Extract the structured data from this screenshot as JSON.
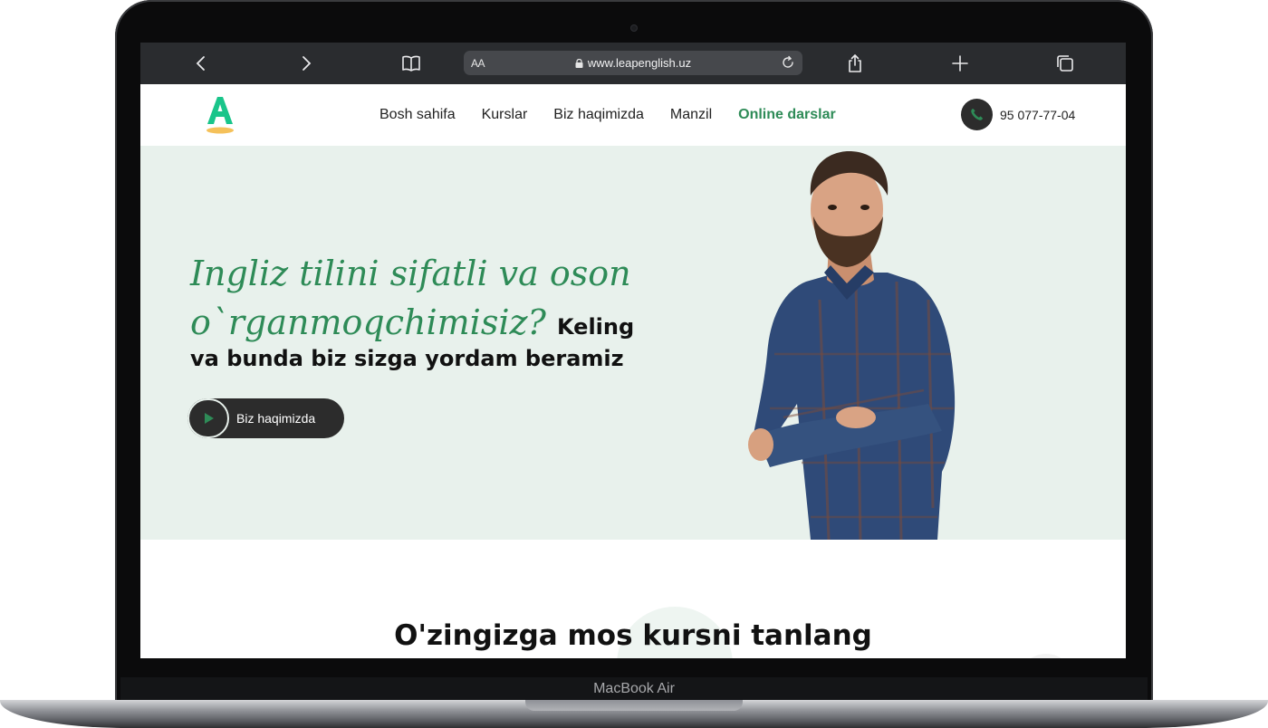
{
  "device": {
    "label": "MacBook Air"
  },
  "browser": {
    "text_size_label": "AA",
    "url": "www.leapenglish.uz",
    "icons": [
      "back-icon",
      "forward-icon",
      "bookmarks-icon",
      "lock-icon",
      "reload-icon",
      "share-icon",
      "new-tab-icon",
      "tabs-icon"
    ]
  },
  "site": {
    "nav": [
      {
        "label": "Bosh sahifa"
      },
      {
        "label": "Kurslar"
      },
      {
        "label": "Biz haqimizda"
      },
      {
        "label": "Manzil"
      },
      {
        "label": "Online darslar",
        "active": true
      }
    ],
    "phone": "95 077-77-04",
    "hero": {
      "headline_green_1": "Ingliz tilini sifatli va oson",
      "headline_green_2": "o`rganmoqchimisiz?",
      "headline_black_1": "Keling",
      "headline_black_2": "va bunda biz sizga yordam beramiz",
      "cta_label": "Biz haqimizda"
    },
    "section_title": "O'zingizga mos kursni tanlang"
  },
  "colors": {
    "accent_green": "#2e8b57",
    "hero_bg": "#e8f1ec",
    "toolbar_bg": "#2a2c2f",
    "logo_green": "#19c58a",
    "logo_yellow": "#f5c15a"
  }
}
